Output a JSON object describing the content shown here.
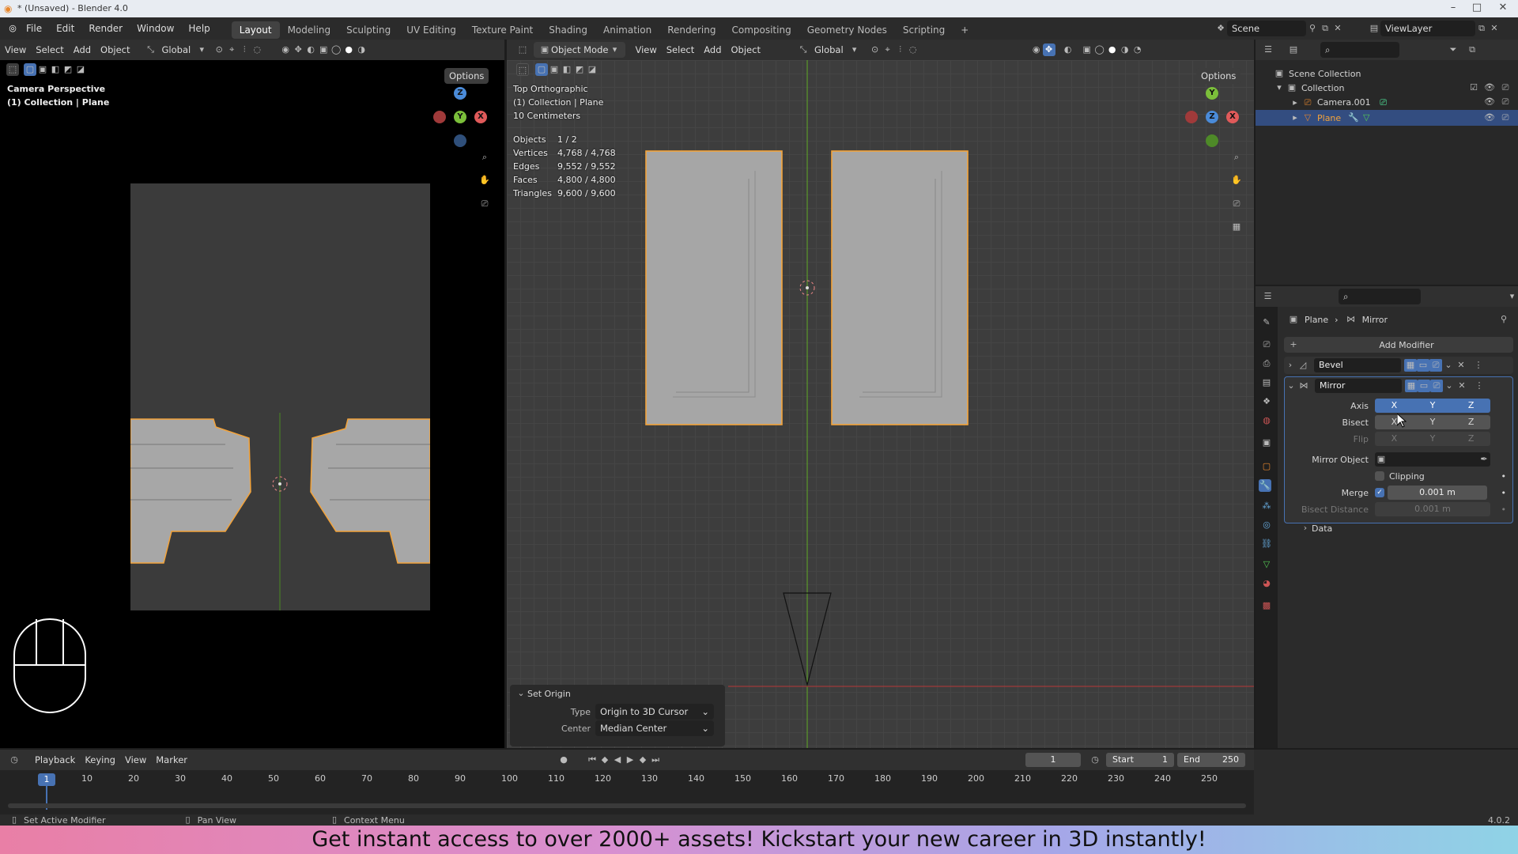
{
  "window": {
    "title": "* (Unsaved) - Blender 4.0"
  },
  "menu": [
    "File",
    "Edit",
    "Render",
    "Window",
    "Help"
  ],
  "workspaces": [
    "Layout",
    "Modeling",
    "Sculpting",
    "UV Editing",
    "Texture Paint",
    "Shading",
    "Animation",
    "Rendering",
    "Compositing",
    "Geometry Nodes",
    "Scripting"
  ],
  "active_workspace": "Layout",
  "scene": {
    "name": "Scene",
    "viewlayer": "ViewLayer"
  },
  "left_viewport": {
    "menus": [
      "View",
      "Select",
      "Add",
      "Object"
    ],
    "transform": "Global",
    "options": "Options",
    "overlay_title": "Camera Perspective",
    "overlay_sub": "(1) Collection | Plane"
  },
  "right_viewport": {
    "mode": "Object Mode",
    "menus": [
      "View",
      "Select",
      "Add",
      "Object"
    ],
    "transform": "Global",
    "options": "Options",
    "overlay_title": "Top Orthographic",
    "overlay_sub": "(1) Collection | Plane",
    "overlay_scale": "10 Centimeters",
    "stats": [
      {
        "label": "Objects",
        "value": "1 / 2"
      },
      {
        "label": "Vertices",
        "value": "4,768 / 4,768"
      },
      {
        "label": "Edges",
        "value": "9,552 / 9,552"
      },
      {
        "label": "Faces",
        "value": "4,800 / 4,800"
      },
      {
        "label": "Triangles",
        "value": "9,600 / 9,600"
      }
    ]
  },
  "set_origin": {
    "title": "Set Origin",
    "type_label": "Type",
    "type_value": "Origin to 3D Cursor",
    "center_label": "Center",
    "center_value": "Median Center"
  },
  "outliner": {
    "root": "Scene Collection",
    "collection": "Collection",
    "items": [
      "Camera.001",
      "Plane"
    ]
  },
  "properties": {
    "breadcrumb_object": "Plane",
    "breadcrumb_modifier": "Mirror",
    "add_modifier": "Add Modifier",
    "modifiers": [
      "Bevel",
      "Mirror"
    ],
    "axis_label": "Axis",
    "bisect_label": "Bisect",
    "flip_label": "Flip",
    "xyz": [
      "X",
      "Y",
      "Z"
    ],
    "mirror_object_label": "Mirror Object",
    "clipping_label": "Clipping",
    "merge_label": "Merge",
    "merge_value": "0.001 m",
    "bisect_distance_label": "Bisect Distance",
    "bisect_distance_value": "0.001 m",
    "data_label": "Data"
  },
  "timeline": {
    "menus": [
      "Playback",
      "Keying",
      "View",
      "Marker"
    ],
    "current_frame": "1",
    "start_label": "Start",
    "start_value": "1",
    "end_label": "End",
    "end_value": "250",
    "ticks": [
      "10",
      "20",
      "30",
      "40",
      "50",
      "60",
      "70",
      "80",
      "90",
      "100",
      "110",
      "120",
      "130",
      "140",
      "150",
      "160",
      "170",
      "180",
      "190",
      "200",
      "210",
      "220",
      "230",
      "240",
      "250"
    ]
  },
  "statusbar": {
    "hint1": "Set Active Modifier",
    "hint2": "Pan View",
    "hint3": "Context Menu",
    "version": "4.0.2"
  },
  "banner": "Get instant access to over 2000+ assets! Kickstart your new career in 3D instantly!",
  "colors": {
    "accent": "#4772b3",
    "selection_orange": "#f3a33a",
    "x_axis": "#e05a5a",
    "y_axis": "#7bbf3a",
    "z_axis": "#4a8bd9"
  }
}
